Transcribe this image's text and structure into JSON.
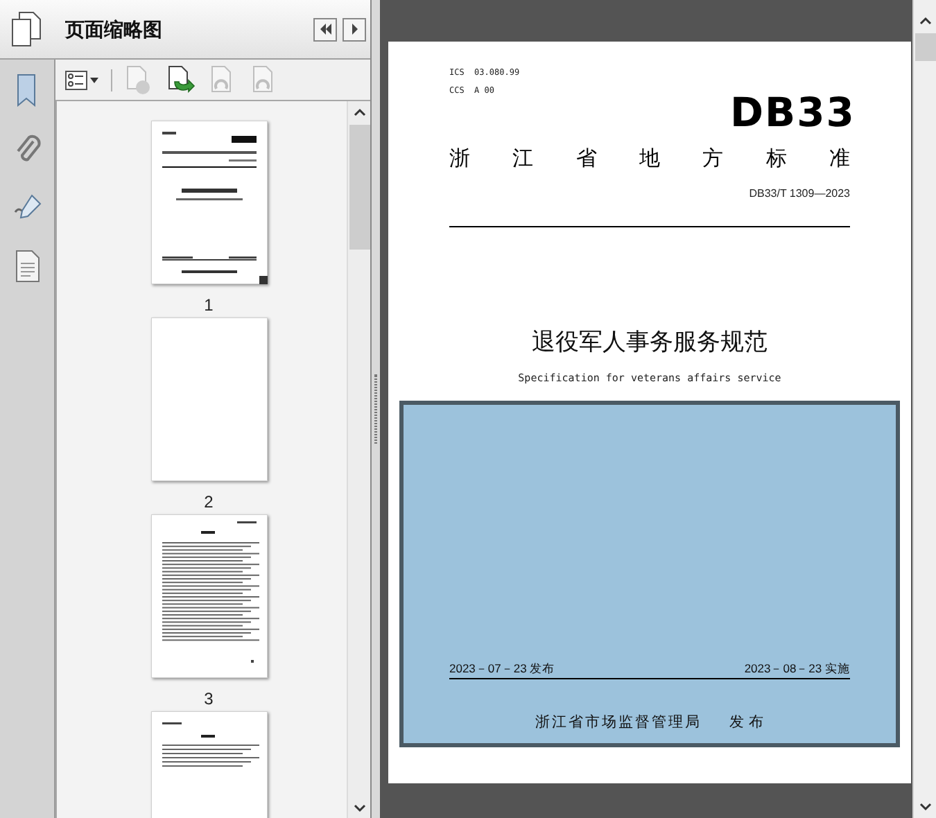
{
  "panel": {
    "title": "页面缩略图"
  },
  "thumbnails": [
    {
      "label": "1",
      "kind": "cover"
    },
    {
      "label": "2",
      "kind": "blank"
    },
    {
      "label": "3",
      "kind": "toc"
    },
    {
      "kind": "text"
    }
  ],
  "document": {
    "ics": "ICS  03.080.99",
    "ccs": "CCS  A 00",
    "logo": "DB33",
    "standard_type": [
      "浙",
      "江",
      "省",
      "地",
      "方",
      "标",
      "准"
    ],
    "number": "DB33/T 1309—2023",
    "title": "退役军人事务服务规范",
    "subtitle": "Specification for veterans affairs service",
    "publish_date": "2023－07－23 发布",
    "effective_date": "2023－08－23 实施",
    "publisher": "浙江省市场监督管理局",
    "publisher_action": "发 布"
  }
}
